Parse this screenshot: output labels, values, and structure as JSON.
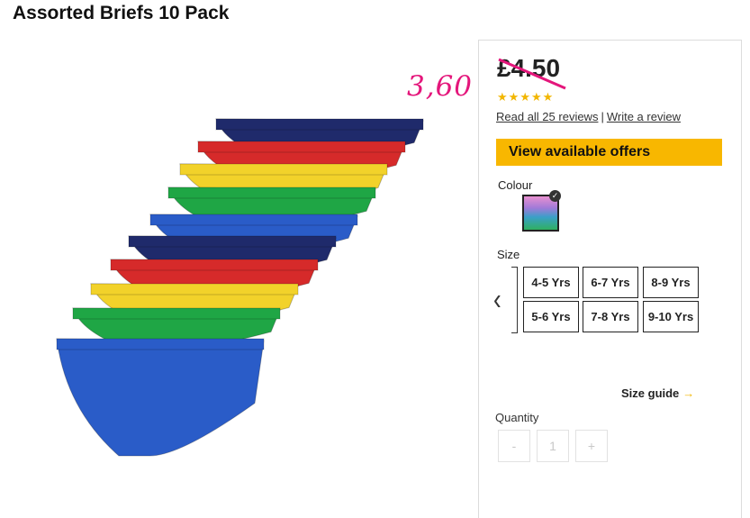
{
  "product": {
    "title": "Assorted Briefs 10 Pack"
  },
  "price": {
    "current": "£4.50",
    "handwritten": "3,60",
    "stars": 5
  },
  "reviews": {
    "read_label": "Read all 25 reviews",
    "separator": "|",
    "write_label": "Write a review"
  },
  "offers": {
    "label": "View available offers"
  },
  "colour": {
    "label": "Colour"
  },
  "size": {
    "label": "Size",
    "options": [
      "4-5 Yrs",
      "6-7 Yrs",
      "8-9 Yrs",
      "5-6 Yrs",
      "7-8 Yrs",
      "9-10 Yrs"
    ],
    "guide_label": "Size guide",
    "guide_arrow": "→"
  },
  "quantity": {
    "label": "Quantity",
    "minus": "-",
    "value": "1",
    "plus": "+"
  },
  "colors": {
    "accent": "#f8b700",
    "handwriting": "#e4167b",
    "star": "#f2b600"
  },
  "icons": {
    "prev": "chevron-left-icon",
    "check": "check-icon",
    "star": "star-icon"
  }
}
